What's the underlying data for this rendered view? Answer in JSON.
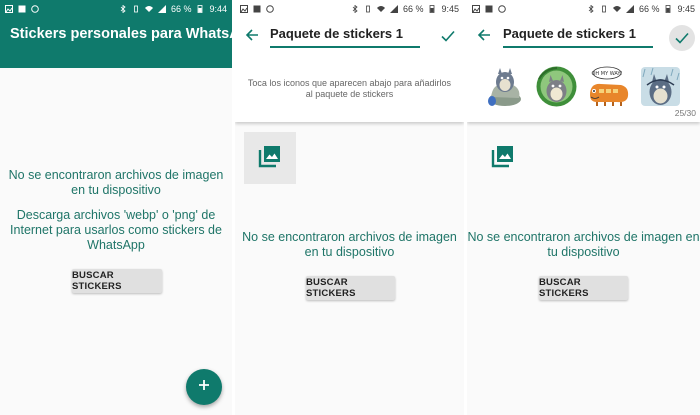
{
  "colors": {
    "primary": "#0f7a6c",
    "message": "#1f7568",
    "button_bg": "#e0e0e0"
  },
  "statusbar": {
    "screen1": {
      "battery": "66 %",
      "time": "9:44"
    },
    "screen2": {
      "battery": "66 %",
      "time": "9:45"
    },
    "screen3": {
      "battery": "66 %",
      "time": "9:45"
    }
  },
  "screen1": {
    "title": "Stickers personales para WhatsApp",
    "empty_message": "No se encontraron archivos de imagen en tu dispositivo",
    "download_hint": "Descarga archivos 'webp' o 'png' de Internet para usarlos como stickers de WhatsApp",
    "search_button": "BUSCAR STICKERS",
    "fab_icon": "plus-icon"
  },
  "screen2": {
    "pack_name": "Paquete de stickers 1",
    "hint": "Toca los iconos que aparecen abajo para añadirlos al paquete de stickers",
    "empty_message": "No se encontraron archivos de imagen en tu dispositivo",
    "search_button": "BUSCAR STICKERS"
  },
  "screen3": {
    "pack_name": "Paquete de stickers 1",
    "sticker_count": "25/30",
    "sticker_speech_text": "OH MY WAY!",
    "empty_message": "No se encontraron archivos de imagen en tu dispositivo",
    "search_button": "BUSCAR STICKERS"
  }
}
